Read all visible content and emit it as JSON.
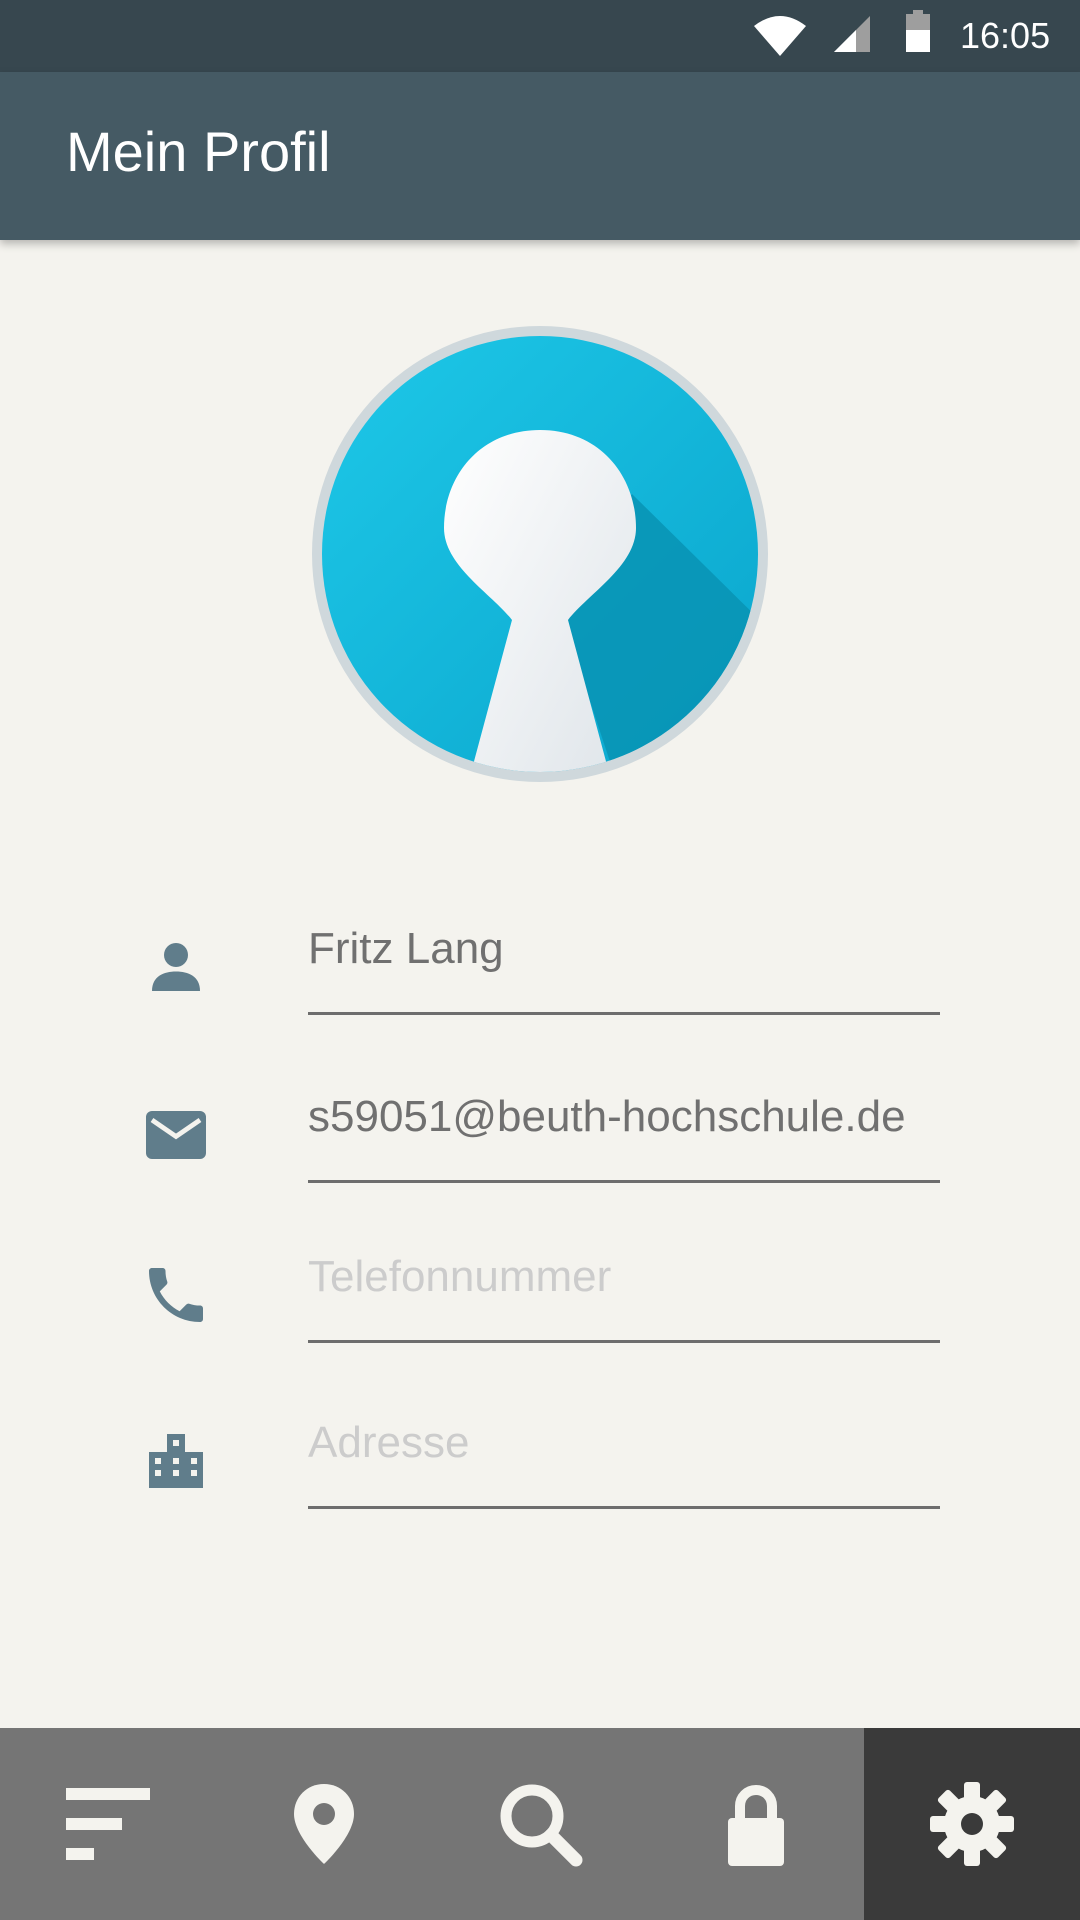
{
  "status_bar": {
    "time": "16:05",
    "icons": [
      "wifi-icon",
      "cell-signal-icon",
      "battery-icon"
    ]
  },
  "app_bar": {
    "title": "Mein Profil"
  },
  "profile": {
    "avatar_icon": "keyhole-logo",
    "fields": [
      {
        "icon": "person-icon",
        "value": "Fritz Lang",
        "placeholder": ""
      },
      {
        "icon": "mail-icon",
        "value": "s59051@beuth-hochschule.de",
        "placeholder": ""
      },
      {
        "icon": "phone-icon",
        "value": "",
        "placeholder": "Telefonnummer"
      },
      {
        "icon": "building-icon",
        "value": "",
        "placeholder": "Adresse"
      }
    ]
  },
  "bottom_nav": {
    "items": [
      {
        "icon": "filter-list-icon",
        "active": false
      },
      {
        "icon": "location-pin-icon",
        "active": false
      },
      {
        "icon": "search-icon",
        "active": false
      },
      {
        "icon": "lock-icon",
        "active": false
      },
      {
        "icon": "settings-gear-icon",
        "active": true
      }
    ]
  },
  "colors": {
    "status_bar": "#37474f",
    "app_bar": "#455a64",
    "background": "#f4f3ee",
    "accent": "#1ab8dc",
    "icon": "#607d8b",
    "nav_bar": "#757575",
    "nav_active": "#3a3a3a"
  }
}
